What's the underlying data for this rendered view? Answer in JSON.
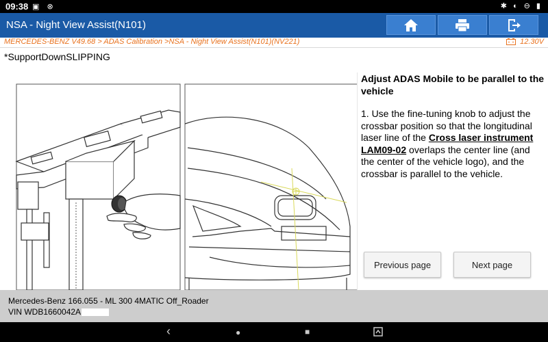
{
  "status_bar": {
    "time": "09:38",
    "left_icons": "▣ ⊗",
    "right_icons": "✱ ◐ ⊖ ▮"
  },
  "title_bar": {
    "title": "NSA - Night View Assist(N101)",
    "buttons": [
      "home-icon",
      "print-icon",
      "exit-icon"
    ]
  },
  "breadcrumb": {
    "path": "MERCEDES-BENZ V49.68 > ADAS Calibration >NSA - Night View Assist(N101)(NV221)",
    "voltage": "12.30V"
  },
  "support_text": "*SupportDownSLIPPING",
  "instructions": {
    "heading": "Adjust ADAS Mobile to be parallel to the vehicle",
    "body_before": "1. Use the fine-tuning knob to adjust the crossbar position so that the longitudinal laser line of the ",
    "body_bold": "Cross laser instrument LAM09-02",
    "body_after": " overlaps the center line (and the center of the vehicle logo), and the crossbar is parallel to the vehicle."
  },
  "buttons": {
    "previous": "Previous page",
    "next": "Next page"
  },
  "vehicle": {
    "model": "Mercedes-Benz 166.055 - ML 300 4MATIC Off_Roader",
    "vin": "VIN WDB1660042A"
  },
  "android_nav": {
    "back": "‹",
    "home": "●",
    "recent": "■"
  },
  "colors": {
    "title_bar": "#1a5aa6",
    "title_button": "#3a7fd0",
    "breadcrumb_text": "#e8711d",
    "vehicle_bar": "#cdcdcd"
  }
}
